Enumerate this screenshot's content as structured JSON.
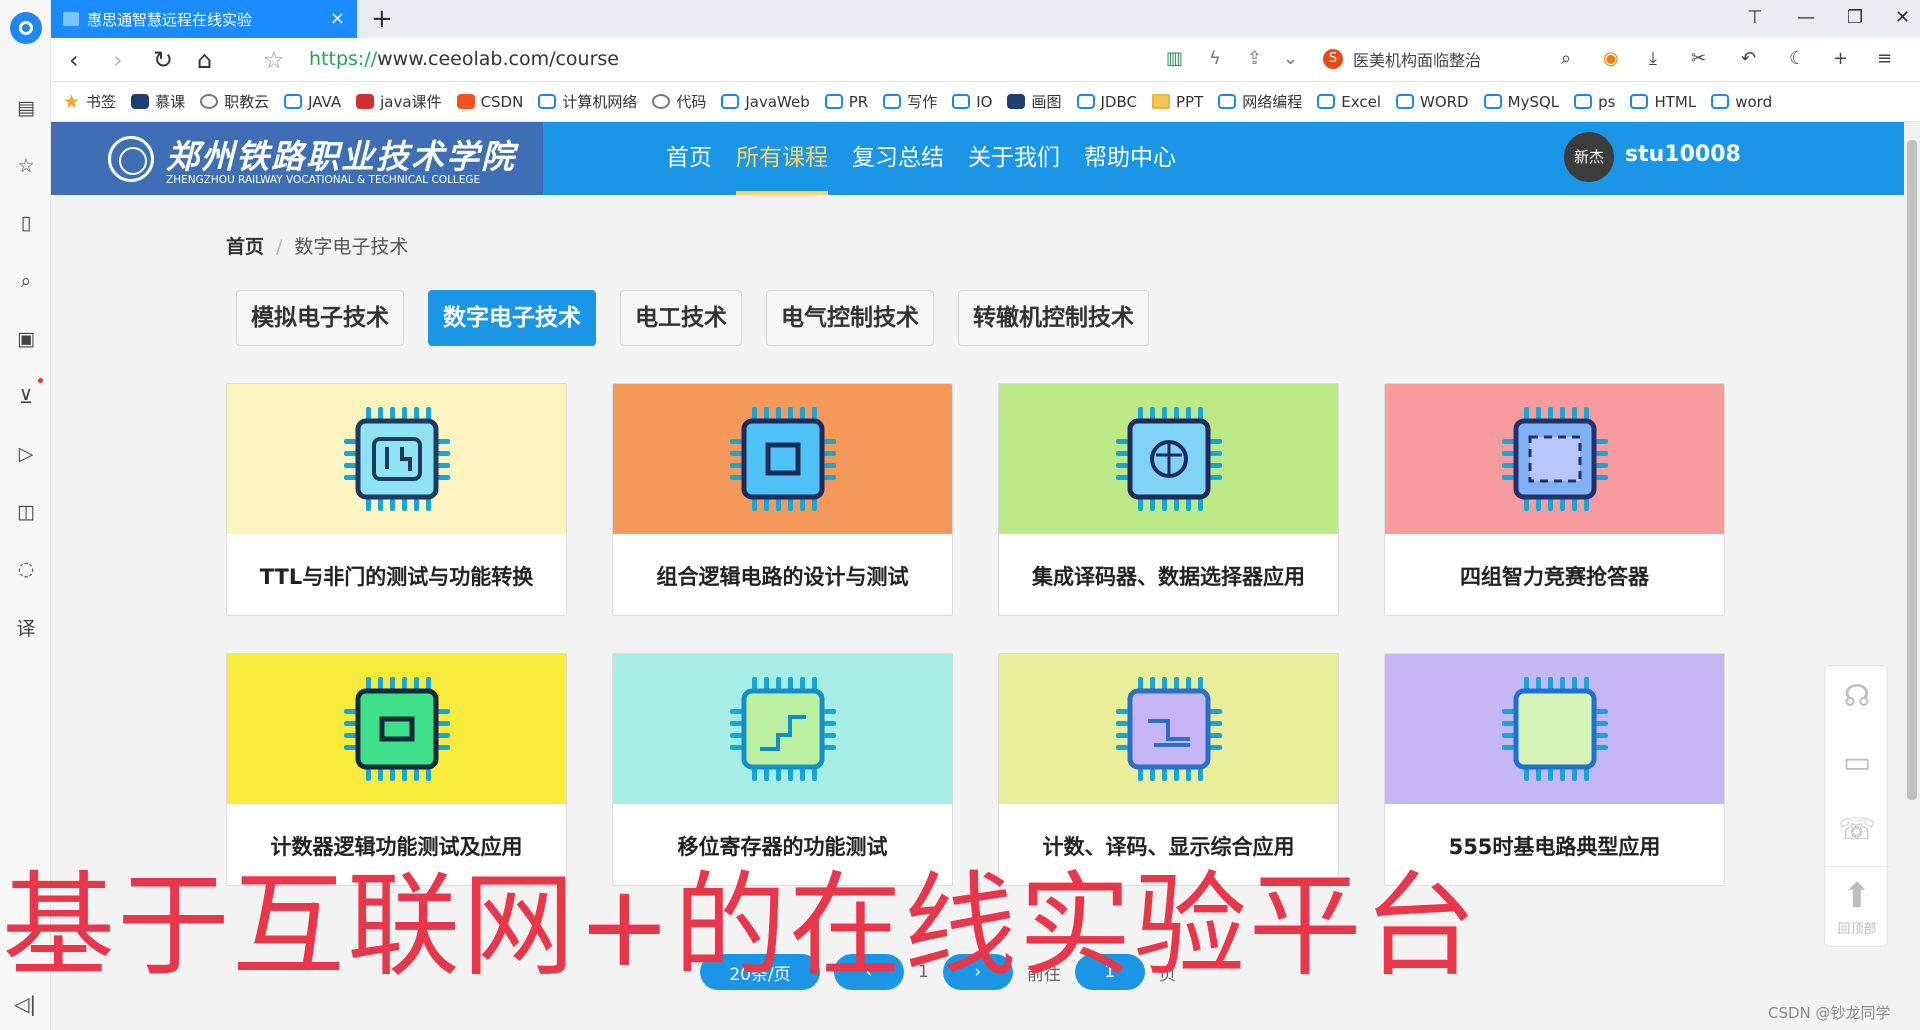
{
  "browser": {
    "tab_title": "惠思通智慧远程在线实验",
    "tab_close": "×",
    "new_tab": "+",
    "url_scheme": "https://",
    "url_rest": "www.ceeolab.com/course",
    "search_engine_glyph": "S",
    "search_hint": "医美机构面临整治",
    "bookmarks": [
      {
        "label": "书签",
        "icon": "star-icon"
      },
      {
        "label": "慕课",
        "icon": "flag-icon"
      },
      {
        "label": "职教云",
        "icon": "cloud-icon"
      },
      {
        "label": "JAVA",
        "icon": "tv-icon"
      },
      {
        "label": "java课件",
        "icon": "speed-icon"
      },
      {
        "label": "CSDN",
        "icon": "csdn-icon"
      },
      {
        "label": "计算机网络",
        "icon": "tv-icon"
      },
      {
        "label": "代码",
        "icon": "globe-icon"
      },
      {
        "label": "JavaWeb",
        "icon": "tv-icon"
      },
      {
        "label": "PR",
        "icon": "tv-icon"
      },
      {
        "label": "写作",
        "icon": "tv-icon"
      },
      {
        "label": "IO",
        "icon": "tv-icon"
      },
      {
        "label": "画图",
        "icon": "on-icon"
      },
      {
        "label": "JDBC",
        "icon": "tv-icon"
      },
      {
        "label": "PPT",
        "icon": "folder-icon"
      },
      {
        "label": "网络编程",
        "icon": "tv-icon"
      },
      {
        "label": "Excel",
        "icon": "tv-icon"
      },
      {
        "label": "WORD",
        "icon": "tv-icon"
      },
      {
        "label": "MySQL",
        "icon": "tv-icon"
      },
      {
        "label": "ps",
        "icon": "tv-icon"
      },
      {
        "label": "HTML",
        "icon": "tv-icon"
      },
      {
        "label": "word",
        "icon": "tv-icon"
      }
    ]
  },
  "site": {
    "logo_cn": "郑州铁路职业技术学院",
    "logo_en": "ZHENGZHOU RAILWAY VOCATIONAL & TECHNICAL COLLEGE",
    "nav": [
      {
        "label": "首页",
        "active": false
      },
      {
        "label": "所有课程",
        "active": true
      },
      {
        "label": "复习总结",
        "active": false
      },
      {
        "label": "关于我们",
        "active": false
      },
      {
        "label": "帮助中心",
        "active": false
      }
    ],
    "avatar_text": "新杰",
    "username": "stu10008"
  },
  "breadcrumb": {
    "home": "首页",
    "sep": "/",
    "current": "数字电子技术"
  },
  "categories": [
    {
      "label": "模拟电子技术",
      "active": false
    },
    {
      "label": "数字电子技术",
      "active": true
    },
    {
      "label": "电工技术",
      "active": false
    },
    {
      "label": "电气控制技术",
      "active": false
    },
    {
      "label": "转辙机控制技术",
      "active": false
    }
  ],
  "courses": [
    {
      "title": "TTL与非门的测试与功能转换",
      "bg": "#fdf3bf",
      "icon": "chip-circuit-icon"
    },
    {
      "title": "组合逻辑电路的设计与测试",
      "bg": "#f5995a",
      "icon": "chip-square-icon"
    },
    {
      "title": "集成译码器、数据选择器应用",
      "bg": "#bdea86",
      "icon": "chip-brain-icon"
    },
    {
      "title": "四组智力竞赛抢答器",
      "bg": "#f79b9e",
      "icon": "chip-frame-icon"
    },
    {
      "title": "计数器逻辑功能测试及应用",
      "bg": "#f9eb3b",
      "icon": "chip-green-icon"
    },
    {
      "title": "移位寄存器的功能测试",
      "bg": "#a6ede6",
      "icon": "chip-board-icon"
    },
    {
      "title": "计数、译码、显示综合应用",
      "bg": "#e9ee9a",
      "icon": "chip-purple-icon"
    },
    {
      "title": "555时基电路典型应用",
      "bg": "#c5b6f4",
      "icon": "chip-light-icon"
    }
  ],
  "float_tools": {
    "back_top_label": "回顶部"
  },
  "pager": {
    "page_size": "20条/页",
    "current_page": "1",
    "goto": "前往",
    "goto_value": "1",
    "page_unit": "页"
  },
  "overlay_caption": "基于互联网+的在线实验平台",
  "watermark": "CSDN @钞龙同学"
}
